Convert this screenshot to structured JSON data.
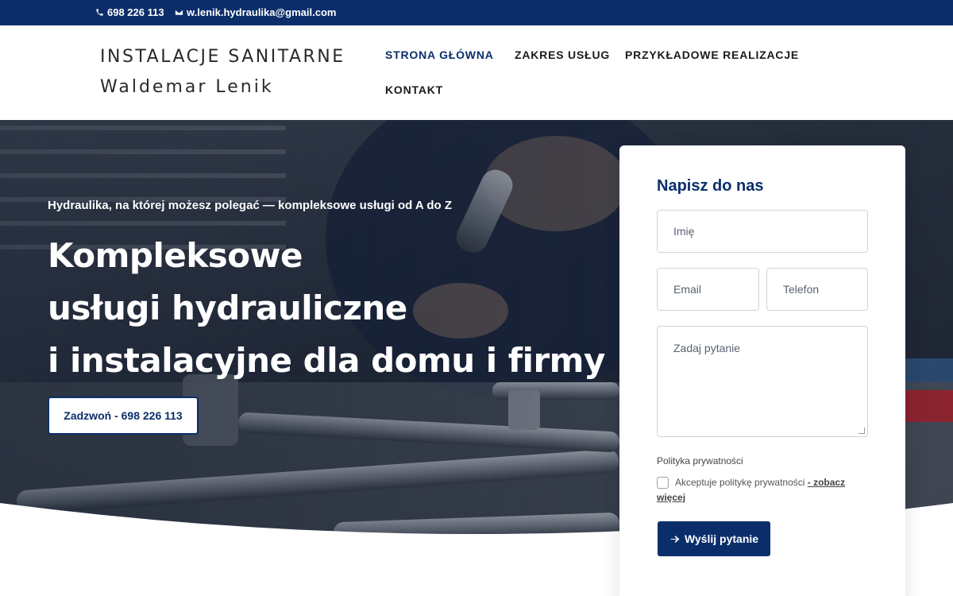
{
  "topbar": {
    "phone": "698 226 113",
    "email": "w.lenik.hydraulika@gmail.com"
  },
  "logo": {
    "line1": "INSTALACJE SANITARNE",
    "line2": "Waldemar Lenik"
  },
  "nav": {
    "items": [
      {
        "label": "Strona główna",
        "active": true
      },
      {
        "label": "Zakres usług",
        "active": false
      },
      {
        "label": "Przykładowe realizacje",
        "active": false
      },
      {
        "label": "Kontakt",
        "active": false
      }
    ]
  },
  "hero": {
    "eyebrow": "Hydraulika, na której możesz polegać — kompleksowe usługi od A do Z",
    "headline": [
      "Kompleksowe",
      "usługi hydrauliczne",
      "i instalacyjne dla domu i firmy"
    ],
    "call_button": "Zadzwoń - 698 226 113"
  },
  "form": {
    "title": "Napisz do nas",
    "name_placeholder": "Imię",
    "email_placeholder": "Email",
    "phone_placeholder": "Telefon",
    "question_placeholder": "Zadaj pytanie",
    "privacy_label": "Polityka prywatności",
    "consent_text": "Akceptuje politykę prywatności ",
    "consent_link": "- zobacz więcej",
    "submit_label": "Wyślij pytanie"
  },
  "colors": {
    "brand": "#0b2e6b",
    "text_dark": "#1b1b1b",
    "white": "#ffffff"
  },
  "icons": [
    "phone-icon",
    "mail-icon",
    "arrow-right-icon"
  ]
}
